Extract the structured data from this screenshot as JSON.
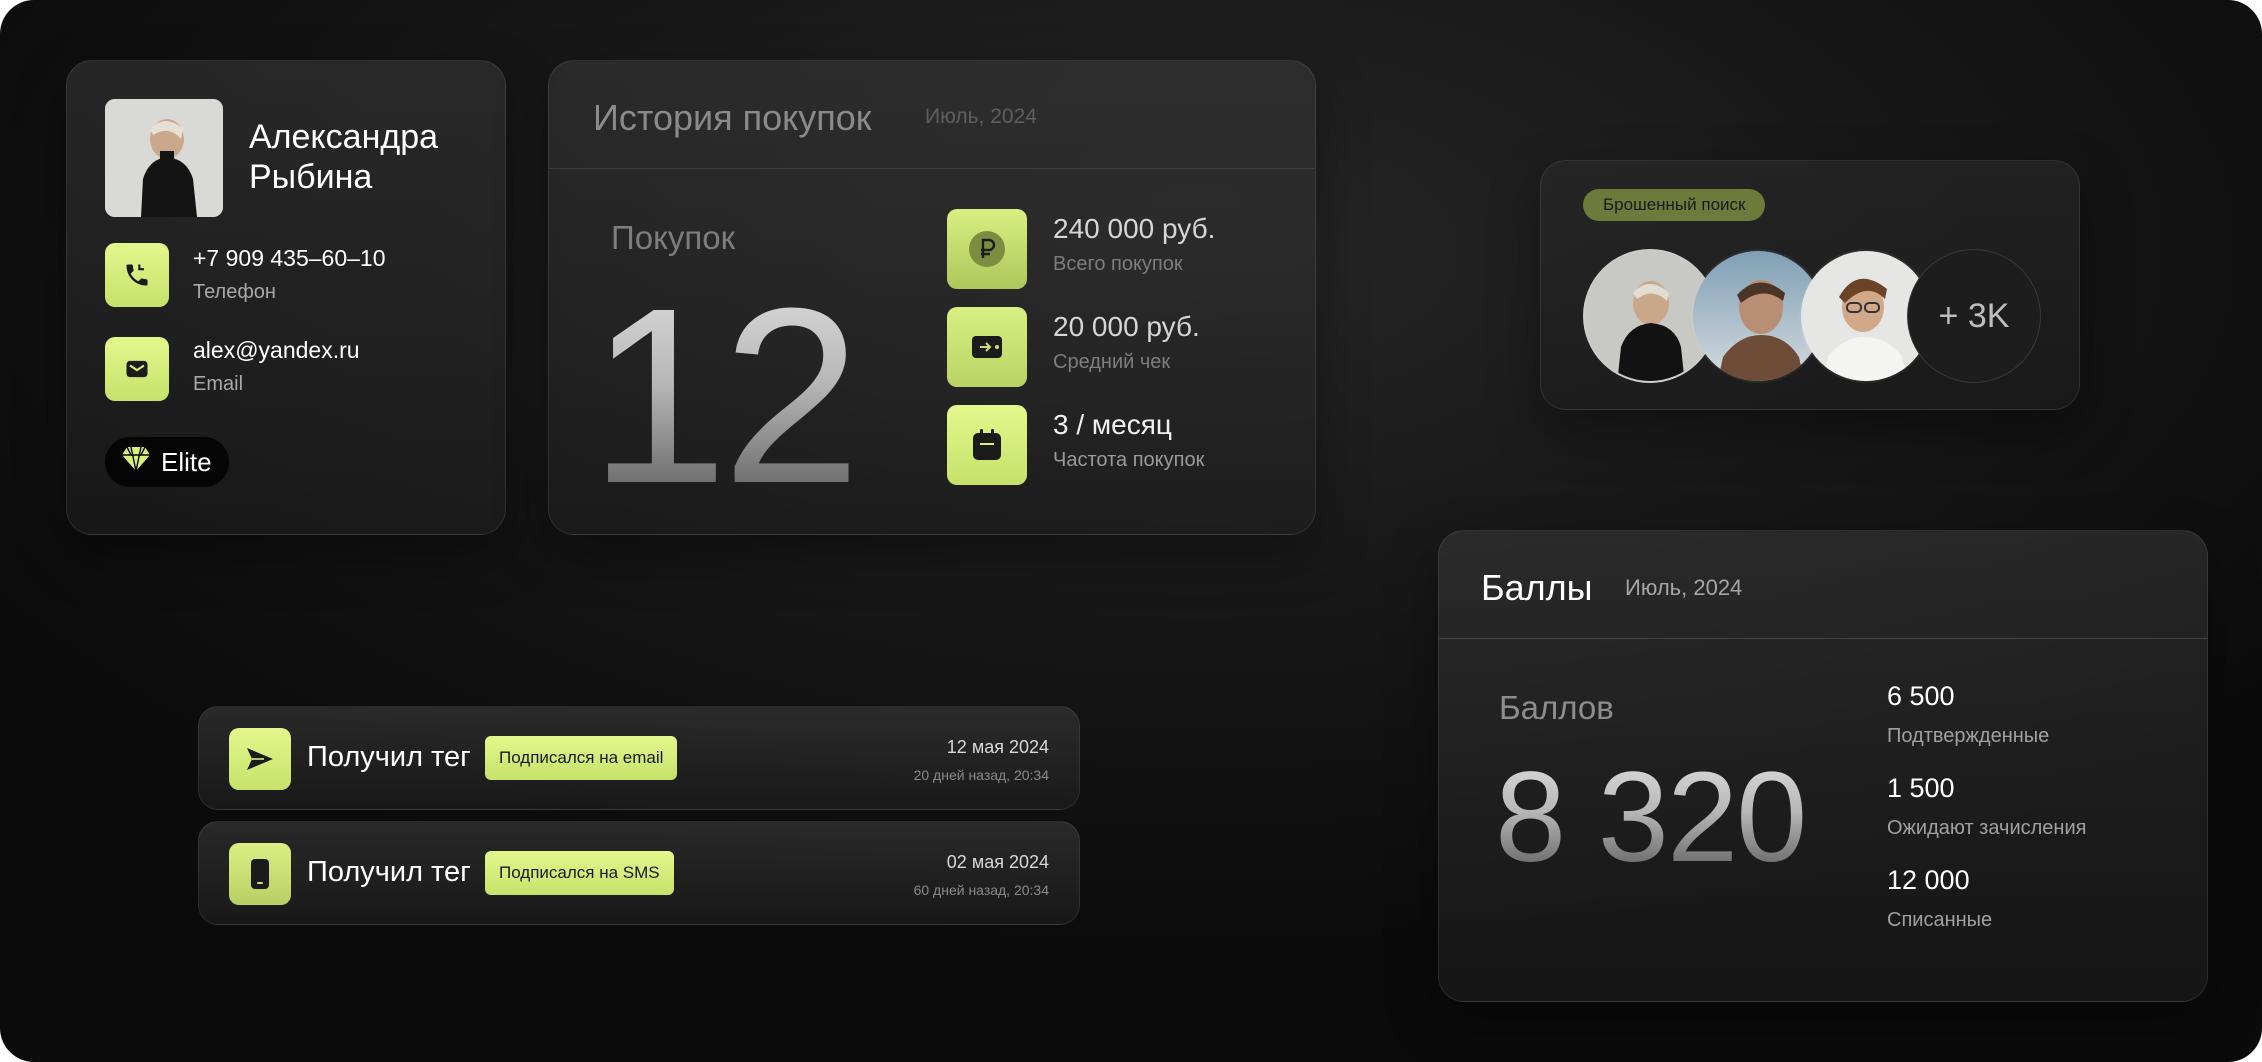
{
  "colors": {
    "accent": "#d8f07a",
    "background": "#131313",
    "chip_olive": "#6d7a3b"
  },
  "profile": {
    "first_name": "Александра",
    "last_name": "Рыбина",
    "phone": "+7 909 435–60–10",
    "phone_label": "Телефон",
    "email": "alex@yandex.ru",
    "email_label": "Email",
    "badge": "Elite",
    "icons": {
      "phone": "phone-icon",
      "email": "mail-icon",
      "badge": "diamond-icon"
    }
  },
  "purchases": {
    "title": "История покупок",
    "period": "Июль, 2024",
    "count_label": "Покупок",
    "count": "12",
    "stats": [
      {
        "value": "240 000 руб.",
        "label": "Всего покупок",
        "icon": "ruble-icon"
      },
      {
        "value": "20 000 руб.",
        "label": "Средний чек",
        "icon": "wallet-icon"
      },
      {
        "value": "3 / месяц",
        "label": "Частота покупок",
        "icon": "calendar-icon"
      }
    ]
  },
  "abandoned": {
    "label": "Брошенный поиск",
    "more": "+ 3K"
  },
  "points": {
    "title": "Баллы",
    "period": "Июль, 2024",
    "total_label": "Баллов",
    "total": "8 320",
    "stats": [
      {
        "value": "6 500",
        "label": "Подтвержденные"
      },
      {
        "value": "1 500",
        "label": "Ожидают зачисления"
      },
      {
        "value": "12 000",
        "label": "Списанные"
      }
    ]
  },
  "tags": [
    {
      "title": "Получил тег",
      "chip": "Подписался на email",
      "date": "12 мая 2024",
      "ago": "20 дней назад, 20:34",
      "icon": "send-icon"
    },
    {
      "title": "Получил тег",
      "chip": "Подписался на SMS",
      "date": "02 мая 2024",
      "ago": "60 дней назад, 20:34",
      "icon": "mobile-icon"
    }
  ]
}
